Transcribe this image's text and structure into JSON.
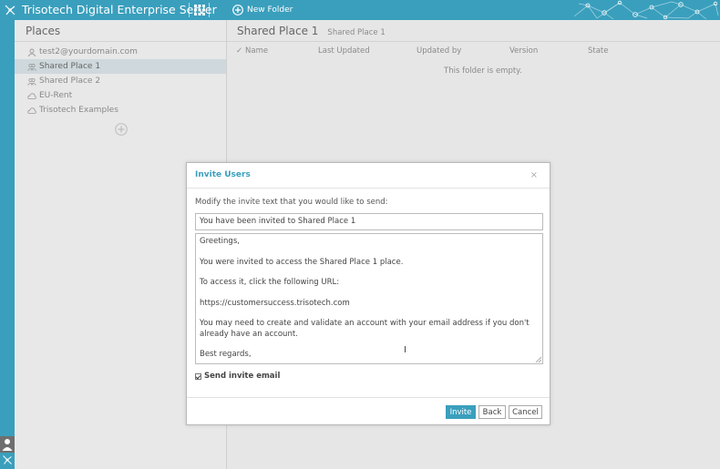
{
  "app": {
    "title": "Trisotech Digital Enterprise Server",
    "accent": "#3a9fbd"
  },
  "toolbar": {
    "new_folder_label": "New Folder"
  },
  "places": {
    "header": "Places",
    "items": [
      {
        "label": "test2@yourdomain.com",
        "icon": "user-icon"
      },
      {
        "label": "Shared Place 1",
        "icon": "people-icon",
        "selected": true
      },
      {
        "label": "Shared Place 2",
        "icon": "people-icon"
      },
      {
        "label": "EU-Rent",
        "icon": "cloud-icon"
      },
      {
        "label": "Trisotech Examples",
        "icon": "cloud-icon"
      }
    ]
  },
  "main": {
    "title": "Shared Place 1",
    "subtitle": "Shared Place 1",
    "columns": [
      "Name",
      "Last Updated",
      "Updated by",
      "Version",
      "State"
    ],
    "empty_text": "This folder is empty."
  },
  "dialog": {
    "title": "Invite Users",
    "close_glyph": "×",
    "prompt": "Modify the invite text that you would like to send:",
    "subject": "You have been invited to Shared Place 1",
    "body_lines": [
      "Greetings,",
      "You were invited to access the Shared Place 1 place.",
      "To access it, click the following URL:",
      "https://customersuccess.trisotech.com",
      "You may need to create and validate an account with your email address if you don't already have an account.",
      "Best regards,"
    ],
    "send_email_label": "Send invite email",
    "send_email_checked": true,
    "buttons": {
      "invite": "Invite",
      "back": "Back",
      "cancel": "Cancel"
    }
  }
}
